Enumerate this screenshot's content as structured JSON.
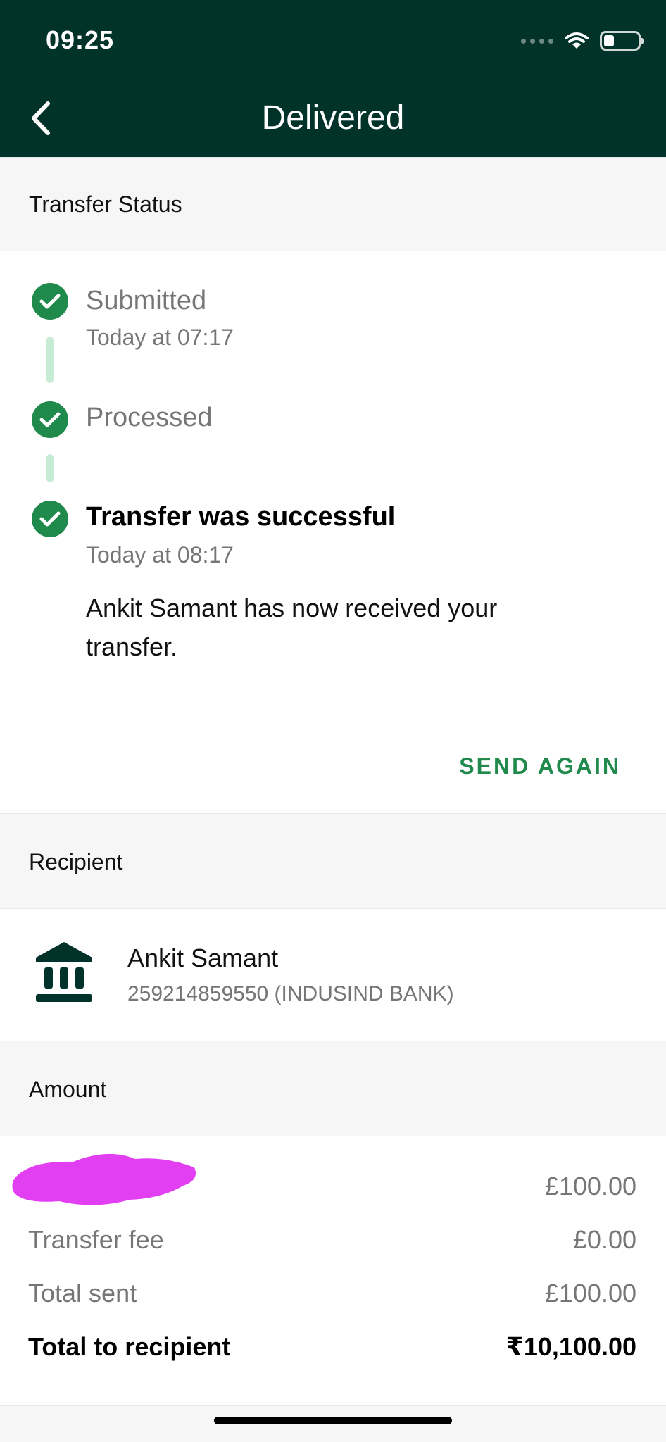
{
  "status_bar": {
    "time": "09:25"
  },
  "header": {
    "title": "Delivered"
  },
  "transfer_status": {
    "section_label": "Transfer Status",
    "steps": [
      {
        "title": "Submitted",
        "subtitle": "Today at 07:17"
      },
      {
        "title": "Processed"
      },
      {
        "title": "Transfer was successful",
        "subtitle": "Today at 08:17",
        "description": "Ankit Samant has now received your transfer."
      }
    ],
    "send_again_label": "SEND AGAIN"
  },
  "recipient": {
    "section_label": "Recipient",
    "name": "Ankit Samant",
    "account": "259214859550 (INDUSIND BANK)"
  },
  "amount": {
    "section_label": "Amount",
    "rows": [
      {
        "label": "",
        "value": "£100.00"
      },
      {
        "label": "Transfer fee",
        "value": "£0.00"
      },
      {
        "label": "Total sent",
        "value": "£100.00"
      },
      {
        "label": "Total to recipient",
        "value": "₹10,100.00"
      }
    ]
  },
  "colors": {
    "header_bg": "#02332a",
    "accent_green": "#1f8a4c",
    "connector_green": "#c7ecd5",
    "redaction_magenta": "#e23ff2"
  }
}
